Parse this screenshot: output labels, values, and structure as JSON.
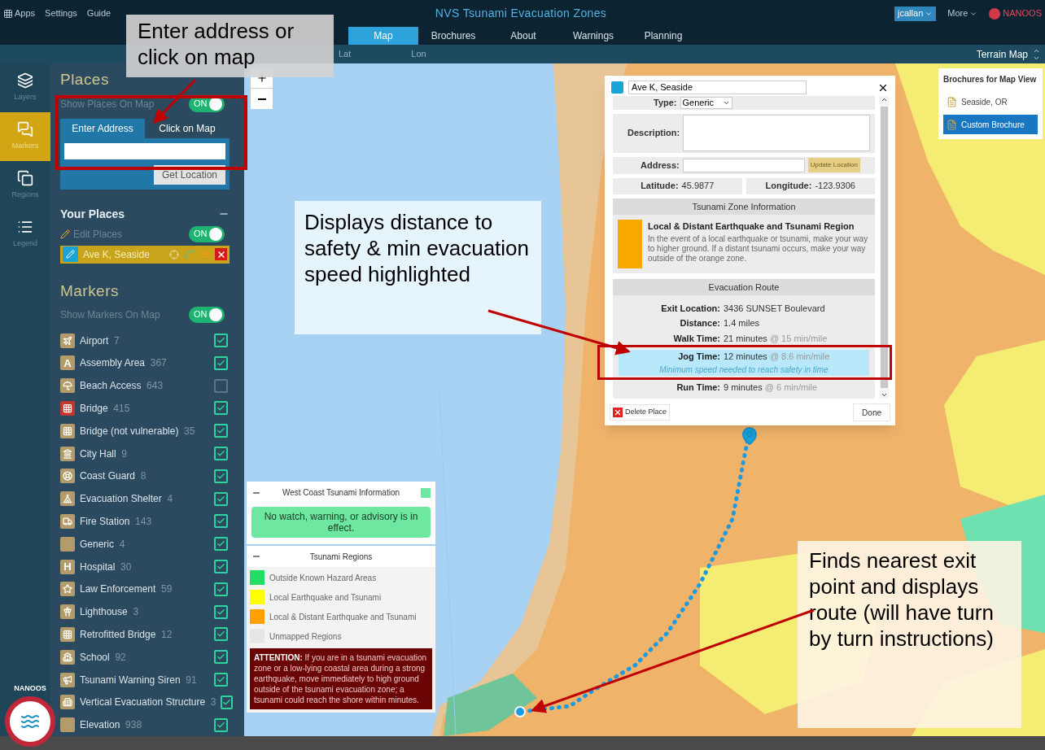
{
  "top_bar": {
    "menu": [
      "Apps",
      "Settings",
      "Guide"
    ],
    "title": "NVS Tsunami Evacuation Zones",
    "user": "jcallan",
    "more": "More",
    "brand": "NANOOS"
  },
  "nav_tabs": [
    {
      "label": "Map",
      "selected": true
    },
    {
      "label": "Brochures",
      "selected": false
    },
    {
      "label": "About",
      "selected": false
    },
    {
      "label": "Warnings",
      "selected": false
    },
    {
      "label": "Planning",
      "selected": false
    }
  ],
  "coord_bar": {
    "lat": "Lat",
    "lon": "Lon",
    "basemap": "Terrain Map"
  },
  "rail": [
    {
      "label": "Layers",
      "kind": "layers",
      "selected": false
    },
    {
      "label": "Markers",
      "kind": "markers",
      "selected": true
    },
    {
      "label": "Regions",
      "kind": "regions",
      "selected": false
    },
    {
      "label": "Legend",
      "kind": "legend",
      "selected": false
    }
  ],
  "places": {
    "title": "Places",
    "show_label": "Show Places On Map",
    "show_on": true,
    "toggle_text": "ON",
    "address_tabs": [
      {
        "label": "Enter Address",
        "selected": true
      },
      {
        "label": "Click on Map",
        "selected": false
      }
    ],
    "get_location": "Get Location",
    "your_places_title": "Your Places",
    "edit_label": "Edit Places",
    "edit_on": true,
    "edit_toggle_text": "ON",
    "items": [
      {
        "name": "Ave K, Seaside"
      }
    ]
  },
  "markers": {
    "title": "Markers",
    "show_label": "Show Markers On Map",
    "show_on": true,
    "toggle_text": "ON",
    "items": [
      {
        "name": "Airport",
        "count": "7",
        "kind": "plane",
        "color": "#b39b6b",
        "checked": true
      },
      {
        "name": "Assembly Area",
        "count": "367",
        "kind": "glyph",
        "glyph": "A",
        "color": "#b39b6b",
        "checked": true
      },
      {
        "name": "Beach Access",
        "count": "643",
        "kind": "umbrella",
        "color": "#b39b6b",
        "checked": false
      },
      {
        "name": "Bridge",
        "count": "415",
        "kind": "bridge",
        "color": "#c0392b",
        "checked": true
      },
      {
        "name": "Bridge (not vulnerable)",
        "count": "35",
        "kind": "bridge",
        "color": "#b39b6b",
        "checked": true
      },
      {
        "name": "City Hall",
        "count": "9",
        "kind": "hall",
        "color": "#b39b6b",
        "checked": true
      },
      {
        "name": "Coast Guard",
        "count": "8",
        "kind": "buoy",
        "color": "#b39b6b",
        "checked": true
      },
      {
        "name": "Evacuation Shelter",
        "count": "4",
        "kind": "shelter",
        "color": "#b39b6b",
        "checked": true
      },
      {
        "name": "Fire Station",
        "count": "143",
        "kind": "truck",
        "color": "#b39b6b",
        "checked": true
      },
      {
        "name": "Generic",
        "count": "4",
        "kind": "blank",
        "color": "#b39b6b",
        "checked": true
      },
      {
        "name": "Hospital",
        "count": "30",
        "kind": "glyph",
        "glyph": "H",
        "color": "#b39b6b",
        "checked": true
      },
      {
        "name": "Law Enforcement",
        "count": "59",
        "kind": "star",
        "color": "#b39b6b",
        "checked": true
      },
      {
        "name": "Lighthouse",
        "count": "3",
        "kind": "lighthouse",
        "color": "#b39b6b",
        "checked": true
      },
      {
        "name": "Retrofitted Bridge",
        "count": "12",
        "kind": "bridge",
        "color": "#b39b6b",
        "checked": true
      },
      {
        "name": "School",
        "count": "92",
        "kind": "school",
        "color": "#b39b6b",
        "checked": true
      },
      {
        "name": "Tsunami Warning Siren",
        "count": "91",
        "kind": "siren",
        "color": "#b39b6b",
        "checked": true
      },
      {
        "name": "Vertical Evacuation Structure",
        "count": "3",
        "kind": "building",
        "color": "#b39b6b",
        "checked": true
      },
      {
        "name": "Elevation",
        "count": "938",
        "kind": "blank",
        "color": "#b39b6b",
        "checked": true
      }
    ]
  },
  "logo": {
    "text": "NANOOS"
  },
  "popup": {
    "name": "Ave K, Seaside",
    "type_label": "Type:",
    "type_value": "Generic",
    "description_label": "Description:",
    "address_label": "Address:",
    "update_button": "Update Location",
    "latitude_label": "Latitude:",
    "latitude": "45.9877",
    "longitude_label": "Longitude:",
    "longitude": "-123.9306",
    "zone_header": "Tsunami Zone Information",
    "zone_title": "Local & Distant Earthquake and Tsunami Region",
    "zone_text": "In the event of a local earthquake or tsunami, make your way to higher ground. If a distant tsunami occurs, make your way outside of the orange zone.",
    "route_header": "Evacuation Route",
    "route": [
      {
        "label": "Exit Location:",
        "value": "3436 SUNSET Boulevard",
        "highlighted": false
      },
      {
        "label": "Distance:",
        "value": "1.4 miles",
        "highlighted": false
      },
      {
        "label": "Walk Time:",
        "value": "21 minutes",
        "pace": "@ 15 min/mile",
        "highlighted": false
      },
      {
        "label": "Jog Time:",
        "value": "12 minutes",
        "pace": "@ 8.6 min/mile",
        "note": "Minimum speed needed to reach safety in time",
        "highlighted": true
      },
      {
        "label": "Run Time:",
        "value": "9 minutes",
        "pace": "@ 6 min/mile",
        "highlighted": false
      }
    ],
    "delete_button": "Delete Place",
    "done_button": "Done"
  },
  "brochures": {
    "title": "Brochures for Map View",
    "items": [
      {
        "label": "Seaside, OR",
        "selected": false
      },
      {
        "label": "Custom Brochure",
        "selected": true
      }
    ]
  },
  "tsunami_info": {
    "title": "West Coast Tsunami Information",
    "message": "No watch, warning, or advisory is in effect."
  },
  "regions": {
    "title": "Tsunami Regions",
    "items": [
      {
        "label": "Outside Known Hazard Areas",
        "color": "#22dd66"
      },
      {
        "label": "Local Earthquake and Tsunami",
        "color": "#ffff00"
      },
      {
        "label": "Local & Distant Earthquake and Tsunami",
        "color": "#ff9f00"
      },
      {
        "label": "Unmapped Regions",
        "color": "#e6e6e6"
      }
    ],
    "attention_label": "ATTENTION:",
    "attention_text": "If you are in a tsunami evacuation zone or a low-lying coastal area during a strong earthquake, move immediately to high ground outside of the tsunami evacuation zone; a tsunami could reach the shore within minutes."
  },
  "annotations": [
    {
      "text": "Enter address or click on map"
    },
    {
      "text": "Displays distance to safety & min evacuation speed highlighted"
    },
    {
      "text": "Finds nearest exit point and displays route (will have turn by turn instructions)"
    }
  ]
}
